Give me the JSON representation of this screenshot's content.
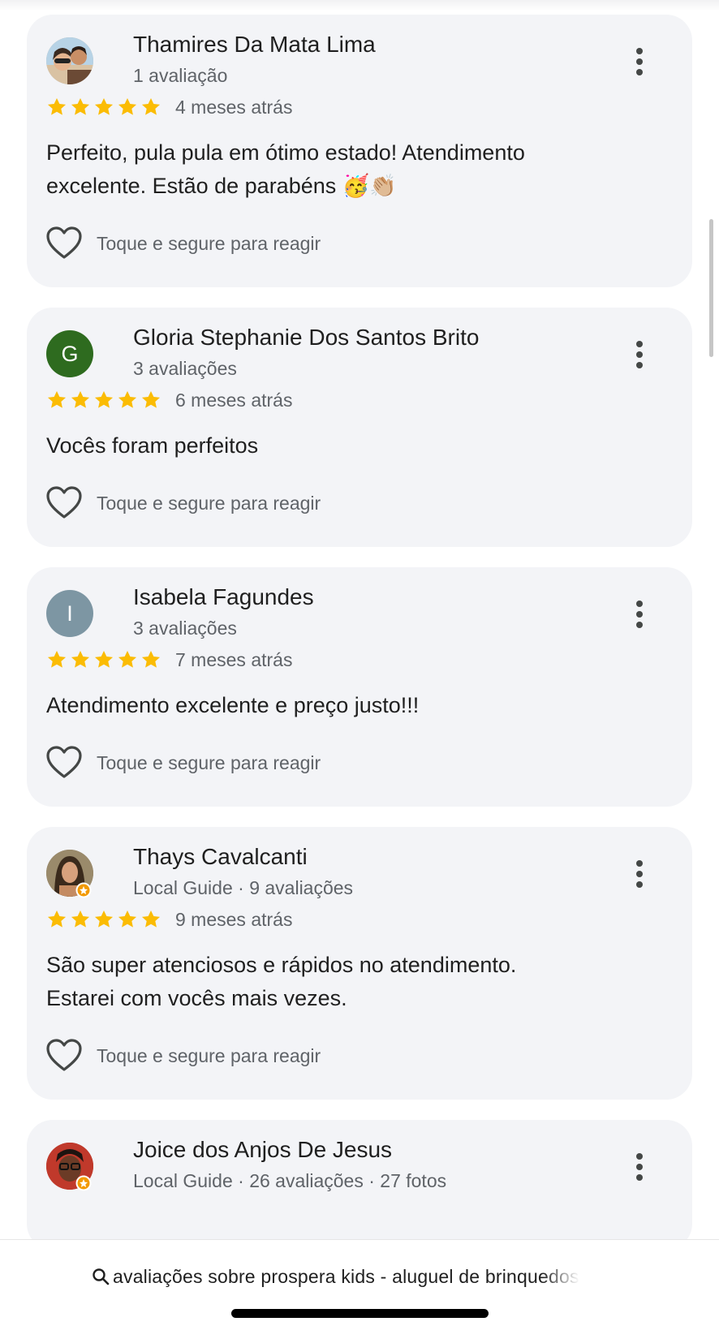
{
  "reviews": [
    {
      "name": "Thamires Da Mata Lima",
      "subtitle": "1 avaliação",
      "rating": 5,
      "date": "4 meses atrás",
      "text": "Perfeito, pula pula em ótimo estado! Atendimento excelente. Estão de parabéns 🥳👏🏼",
      "avatar_icon": "photo-avatar",
      "react_label": "Toque e segure para reagir"
    },
    {
      "name": "Gloria Stephanie Dos Santos Brito",
      "subtitle": "3 avaliações",
      "rating": 5,
      "date": "6 meses atrás",
      "text": "Vocês foram perfeitos",
      "avatar_letter": "G",
      "avatar_color": "#2e6b1f",
      "react_label": "Toque e segure para reagir"
    },
    {
      "name": "Isabela Fagundes",
      "subtitle": "3 avaliações",
      "rating": 5,
      "date": "7 meses atrás",
      "text": "Atendimento excelente e preço justo!!!",
      "avatar_letter": "I",
      "avatar_color": "#7d96a3",
      "react_label": "Toque e segure para reagir"
    },
    {
      "name": "Thays Cavalcanti",
      "subtitle": "Local Guide · 9 avaliações",
      "rating": 5,
      "date": "9 meses atrás",
      "text": "São super atenciosos e rápidos no atendimento. Estarei com vocês mais vezes.",
      "avatar_icon": "photo-avatar",
      "local_guide": true,
      "react_label": "Toque e segure para reagir"
    },
    {
      "name": "Joice dos Anjos De Jesus",
      "subtitle": "Local Guide · 26 avaliações · 27 fotos",
      "avatar_icon": "photo-avatar",
      "local_guide": true
    }
  ],
  "search_bar": {
    "text": "avaliações sobre prospera kids - aluguel de brinquedos"
  },
  "colors": {
    "star": "#fbbc04",
    "card_bg": "#f3f4f7",
    "secondary_text": "#5f6368"
  }
}
